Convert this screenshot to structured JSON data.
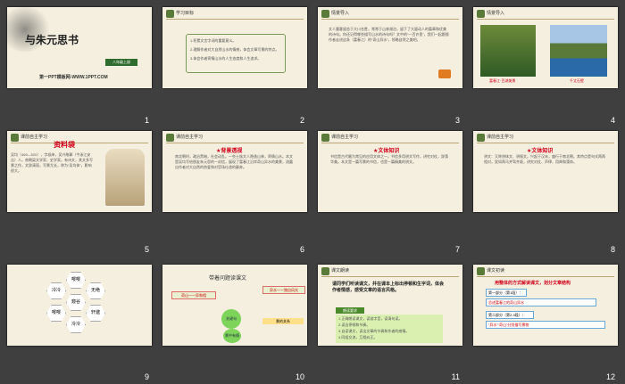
{
  "slides": [
    {
      "num": "1",
      "title": "与朱元思书",
      "grade": "八年级上册",
      "site": "第一PPT模板网-WWW.1PPT.COM"
    },
    {
      "num": "2",
      "header": "学习目标",
      "items": [
        "1.积累文言字词的重要意义。",
        "2.理解作者对大自然山水的情感，体会文章写景的特点。",
        "3.体会作者寄情山水的人生态度和人生追求。"
      ]
    },
    {
      "num": "3",
      "header": "情景导入",
      "text": "文人墨客留恋于大川名胜，常常于山林湖泊，留下了大量动人的篇章和优美的诗句。你还记得哪些描写山水的诗句吗？文中的“一百许里”，我们一起跟随作者走进这条（富春江）的“奇山异水”，领略自然之美吧。"
    },
    {
      "num": "4",
      "header": "情景导入",
      "cap1": "富春江·百湖美景",
      "cap2": "千丈石壁"
    },
    {
      "num": "5",
      "header": "课前自主学习",
      "label": "资料袋",
      "text": "吴均（469—520），字叔庠，吴兴故鄣（今浙江安吉）人。南朝梁文学家、史学家。有诗文，其文多写景之作，文辞清丽，写景尤长，称为“吴均体”，影响很大。"
    },
    {
      "num": "6",
      "header": "课前自主学习",
      "title": "★背景透视",
      "text": "南北朝时，政治黑暗，社会动乱。一些士族文人隐逸山林，寄情山水。本文是吴均写给朋友朱元思的一封信，展现了富春江沿岸奇山异水的美景，流露出作者对大自然的热爱和对官场仕途的鄙弃。"
    },
    {
      "num": "7",
      "header": "课前自主学习",
      "title": "★文体知识",
      "text": "书信是古代最为常见的应用文体之一。书信多用骈文写作，讲究对仗，辞藻华美。本文是一篇写景的书信，也是一篇精美的骈文。"
    },
    {
      "num": "8",
      "header": "课前自主学习",
      "title": "★文体知识",
      "text": "骈文：又称骈体文、骈俪文。兴起于汉末，盛行于南北朝。其特点是句式两两相对，犹如两马并驾齐驱，讲究对仗、声律、用典和藻饰。"
    },
    {
      "num": "9",
      "hex": [
        "冷冷",
        "嘤嘤",
        "无绝",
        "嘤嘤",
        "窥谷",
        "轩邈",
        "泠泠",
        "反"
      ]
    },
    {
      "num": "10",
      "title": "带着问题读课文",
      "b1": "奇山一一异和相",
      "b2": "异水一一独自风光",
      "c1": "关键句",
      "c2": "景中有情",
      "c3": "景的关系"
    },
    {
      "num": "11",
      "header": "课文朗读",
      "t1": "请同学们听读课文，并在课本上标出停顿和生字词，体会作者情感，感受文章的语言风格。",
      "box": "朗读要求",
      "items": [
        "1.正确朗读课文，读准字音，读清句读。",
        "2.读出停顿和节奏。",
        "3.自读课文，读出文章的节奏和作者的感情。",
        "4.同组交流，互相纠正。"
      ]
    },
    {
      "num": "12",
      "header": "课文初读",
      "title": "用整体的方式解读课文，划分文章结构",
      "items": [
        "第一部分（第1段）：",
        "总述富春江的奇山异水",
        "第二部分（第2-3段）：",
        "“异水”“奇山”分别描写景物"
      ]
    }
  ]
}
